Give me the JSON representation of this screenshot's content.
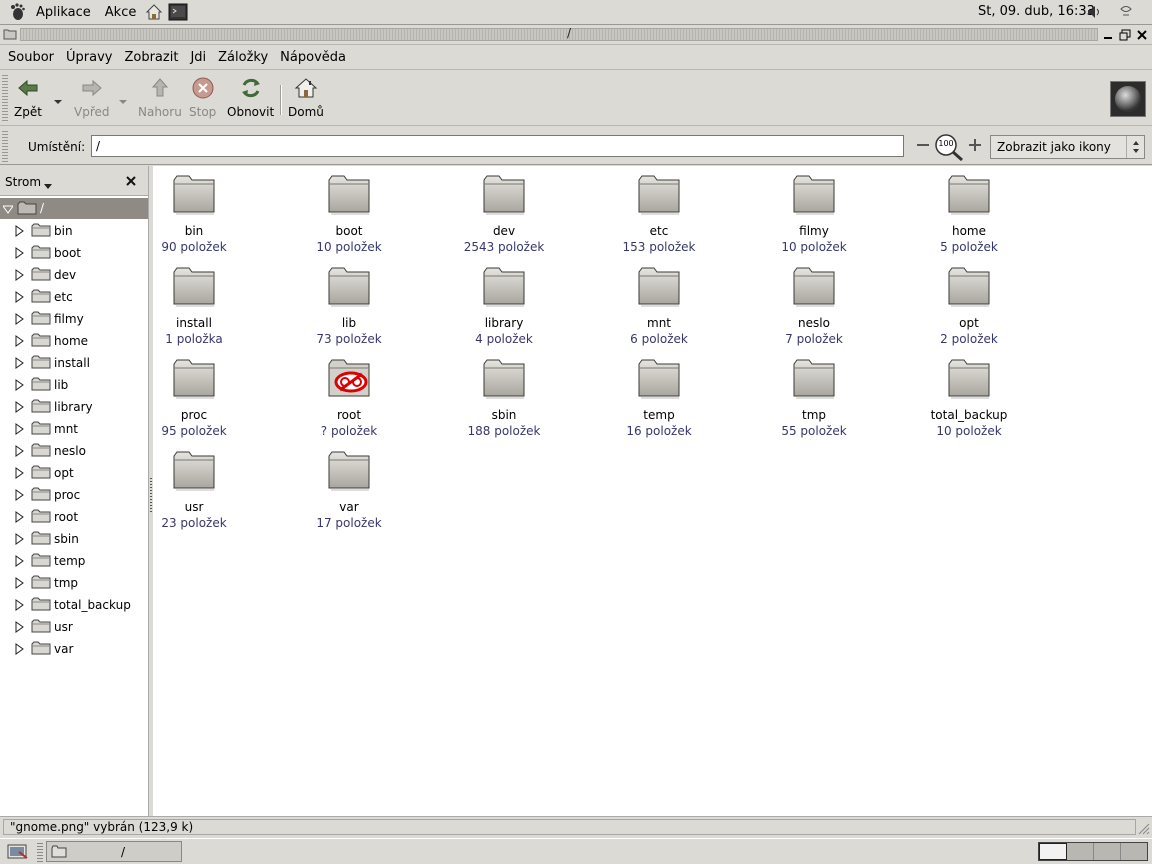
{
  "top_panel": {
    "applications": "Aplikace",
    "actions": "Akce",
    "clock": "St, 09. dub, 16:33"
  },
  "window": {
    "title": "/"
  },
  "menubar": {
    "items": [
      "Soubor",
      "Úpravy",
      "Zobrazit",
      "Jdi",
      "Záložky",
      "Nápověda"
    ]
  },
  "toolbar": {
    "back": "Zpět",
    "forward": "Vpřed",
    "up": "Nahoru",
    "stop": "Stop",
    "reload": "Obnovit",
    "home": "Domů"
  },
  "location": {
    "label": "Umístění:",
    "value": "/",
    "zoom_level": "100",
    "view_mode": "Zobrazit jako ikony"
  },
  "sidebar": {
    "title": "Strom",
    "root": "/",
    "items": [
      "bin",
      "boot",
      "dev",
      "etc",
      "filmy",
      "home",
      "install",
      "lib",
      "library",
      "mnt",
      "neslo",
      "opt",
      "proc",
      "root",
      "sbin",
      "temp",
      "tmp",
      "total_backup",
      "usr",
      "var"
    ]
  },
  "files": [
    {
      "name": "bin",
      "count": "90 položek"
    },
    {
      "name": "boot",
      "count": "10 položek"
    },
    {
      "name": "dev",
      "count": "2543 položek"
    },
    {
      "name": "etc",
      "count": "153 položek"
    },
    {
      "name": "filmy",
      "count": "10 položek"
    },
    {
      "name": "home",
      "count": "5 položek"
    },
    {
      "name": "install",
      "count": "1 položka"
    },
    {
      "name": "lib",
      "count": "73 položek"
    },
    {
      "name": "library",
      "count": "4 položek"
    },
    {
      "name": "mnt",
      "count": "6 položek"
    },
    {
      "name": "neslo",
      "count": "7 položek"
    },
    {
      "name": "opt",
      "count": "2 položek"
    },
    {
      "name": "proc",
      "count": "95 položek"
    },
    {
      "name": "root",
      "count": "? položek",
      "locked": true
    },
    {
      "name": "sbin",
      "count": "188 položek"
    },
    {
      "name": "temp",
      "count": "16 položek"
    },
    {
      "name": "tmp",
      "count": "55 položek"
    },
    {
      "name": "total_backup",
      "count": "10 položek"
    },
    {
      "name": "usr",
      "count": "23 položek"
    },
    {
      "name": "var",
      "count": "17 položek"
    }
  ],
  "statusbar": {
    "text": "\"gnome.png\" vybrán (123,9 k)"
  },
  "taskbar": {
    "task_label": "/"
  },
  "colors": {
    "selection": "#8f8a83",
    "count_text": "#37376d",
    "panel": "#dcdad5"
  }
}
